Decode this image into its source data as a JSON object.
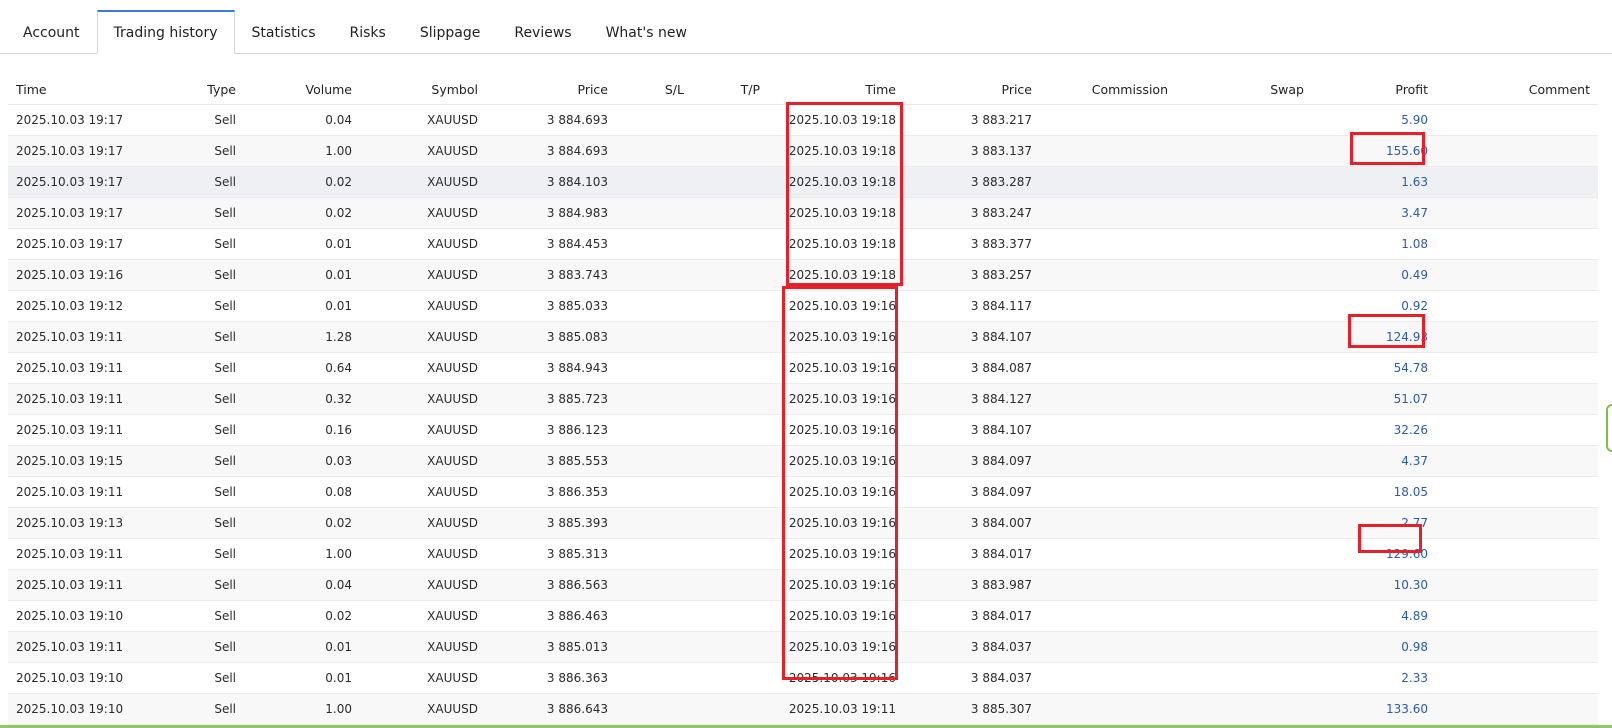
{
  "tabs": [
    {
      "label": "Account",
      "active": false
    },
    {
      "label": "Trading history",
      "active": true
    },
    {
      "label": "Statistics",
      "active": false
    },
    {
      "label": "Risks",
      "active": false
    },
    {
      "label": "Slippage",
      "active": false
    },
    {
      "label": "Reviews",
      "active": false
    },
    {
      "label": "What's new",
      "active": false
    }
  ],
  "table": {
    "headers": [
      "Time",
      "Type",
      "Volume",
      "Symbol",
      "Price",
      "S/L",
      "T/P",
      "Time",
      "Price",
      "Commission",
      "Swap",
      "Profit",
      "Comment"
    ],
    "rows": [
      [
        "2025.10.03 19:17",
        "Sell",
        "0.04",
        "XAUUSD",
        "3 884.693",
        "",
        "",
        "2025.10.03 19:18",
        "3 883.217",
        "",
        "",
        "5.90",
        ""
      ],
      [
        "2025.10.03 19:17",
        "Sell",
        "1.00",
        "XAUUSD",
        "3 884.693",
        "",
        "",
        "2025.10.03 19:18",
        "3 883.137",
        "",
        "",
        "155.60",
        ""
      ],
      [
        "2025.10.03 19:17",
        "Sell",
        "0.02",
        "XAUUSD",
        "3 884.103",
        "",
        "",
        "2025.10.03 19:18",
        "3 883.287",
        "",
        "",
        "1.63",
        ""
      ],
      [
        "2025.10.03 19:17",
        "Sell",
        "0.02",
        "XAUUSD",
        "3 884.983",
        "",
        "",
        "2025.10.03 19:18",
        "3 883.247",
        "",
        "",
        "3.47",
        ""
      ],
      [
        "2025.10.03 19:17",
        "Sell",
        "0.01",
        "XAUUSD",
        "3 884.453",
        "",
        "",
        "2025.10.03 19:18",
        "3 883.377",
        "",
        "",
        "1.08",
        ""
      ],
      [
        "2025.10.03 19:16",
        "Sell",
        "0.01",
        "XAUUSD",
        "3 883.743",
        "",
        "",
        "2025.10.03 19:18",
        "3 883.257",
        "",
        "",
        "0.49",
        ""
      ],
      [
        "2025.10.03 19:12",
        "Sell",
        "0.01",
        "XAUUSD",
        "3 885.033",
        "",
        "",
        "2025.10.03 19:16",
        "3 884.117",
        "",
        "",
        "0.92",
        ""
      ],
      [
        "2025.10.03 19:11",
        "Sell",
        "1.28",
        "XAUUSD",
        "3 885.083",
        "",
        "",
        "2025.10.03 19:16",
        "3 884.107",
        "",
        "",
        "124.93",
        ""
      ],
      [
        "2025.10.03 19:11",
        "Sell",
        "0.64",
        "XAUUSD",
        "3 884.943",
        "",
        "",
        "2025.10.03 19:16",
        "3 884.087",
        "",
        "",
        "54.78",
        ""
      ],
      [
        "2025.10.03 19:11",
        "Sell",
        "0.32",
        "XAUUSD",
        "3 885.723",
        "",
        "",
        "2025.10.03 19:16",
        "3 884.127",
        "",
        "",
        "51.07",
        ""
      ],
      [
        "2025.10.03 19:11",
        "Sell",
        "0.16",
        "XAUUSD",
        "3 886.123",
        "",
        "",
        "2025.10.03 19:16",
        "3 884.107",
        "",
        "",
        "32.26",
        ""
      ],
      [
        "2025.10.03 19:15",
        "Sell",
        "0.03",
        "XAUUSD",
        "3 885.553",
        "",
        "",
        "2025.10.03 19:16",
        "3 884.097",
        "",
        "",
        "4.37",
        ""
      ],
      [
        "2025.10.03 19:11",
        "Sell",
        "0.08",
        "XAUUSD",
        "3 886.353",
        "",
        "",
        "2025.10.03 19:16",
        "3 884.097",
        "",
        "",
        "18.05",
        ""
      ],
      [
        "2025.10.03 19:13",
        "Sell",
        "0.02",
        "XAUUSD",
        "3 885.393",
        "",
        "",
        "2025.10.03 19:16",
        "3 884.007",
        "",
        "",
        "2.77",
        ""
      ],
      [
        "2025.10.03 19:11",
        "Sell",
        "1.00",
        "XAUUSD",
        "3 885.313",
        "",
        "",
        "2025.10.03 19:16",
        "3 884.017",
        "",
        "",
        "129.60",
        ""
      ],
      [
        "2025.10.03 19:11",
        "Sell",
        "0.04",
        "XAUUSD",
        "3 886.563",
        "",
        "",
        "2025.10.03 19:16",
        "3 883.987",
        "",
        "",
        "10.30",
        ""
      ],
      [
        "2025.10.03 19:10",
        "Sell",
        "0.02",
        "XAUUSD",
        "3 886.463",
        "",
        "",
        "2025.10.03 19:16",
        "3 884.017",
        "",
        "",
        "4.89",
        ""
      ],
      [
        "2025.10.03 19:11",
        "Sell",
        "0.01",
        "XAUUSD",
        "3 885.013",
        "",
        "",
        "2025.10.03 19:16",
        "3 884.037",
        "",
        "",
        "0.98",
        ""
      ],
      [
        "2025.10.03 19:10",
        "Sell",
        "0.01",
        "XAUUSD",
        "3 886.363",
        "",
        "",
        "2025.10.03 19:16",
        "3 884.037",
        "",
        "",
        "2.33",
        ""
      ],
      [
        "2025.10.03 19:10",
        "Sell",
        "1.00",
        "XAUUSD",
        "3 886.643",
        "",
        "",
        "2025.10.03 19:11",
        "3 885.307",
        "",
        "",
        "133.60",
        ""
      ]
    ]
  },
  "colors": {
    "active_tab_accent": "#3d7bd8",
    "profit_text": "#2a5ca8",
    "highlight_box": "#e5202a"
  }
}
